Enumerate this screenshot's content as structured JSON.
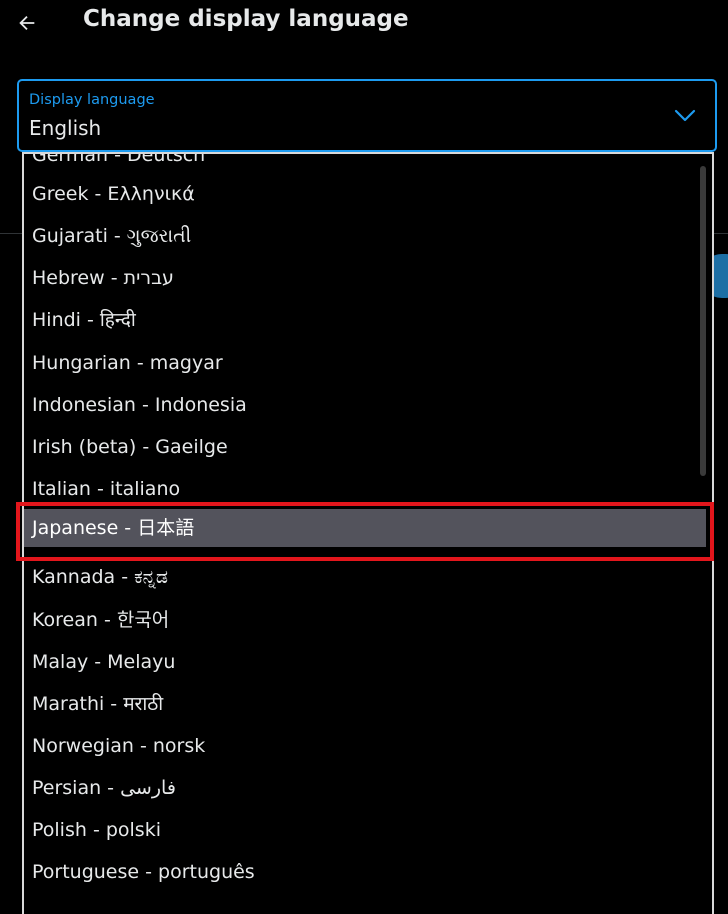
{
  "header": {
    "title": "Change display language"
  },
  "select": {
    "label": "Display language",
    "value": "English"
  },
  "options": [
    "German - Deutsch",
    "Greek - Ελληνικά",
    "Gujarati - ગુજરાતી",
    "Hebrew - עברית",
    "Hindi - हिन्दी",
    "Hungarian - magyar",
    "Indonesian - Indonesia",
    "Irish (beta) - Gaeilge",
    "Italian - italiano",
    "Japanese - 日本語",
    "Kannada - ಕನ್ನಡ",
    "Korean - 한국어",
    "Malay - Melayu",
    "Marathi - मराठी",
    "Norwegian - norsk",
    "Persian - فارسی",
    "Polish - polski",
    "Portuguese - português"
  ],
  "highlighted_option": "Japanese - 日本語",
  "colors": {
    "accent": "#1d9bf0",
    "highlight": "#53535c",
    "annotation": "#e3161c"
  }
}
